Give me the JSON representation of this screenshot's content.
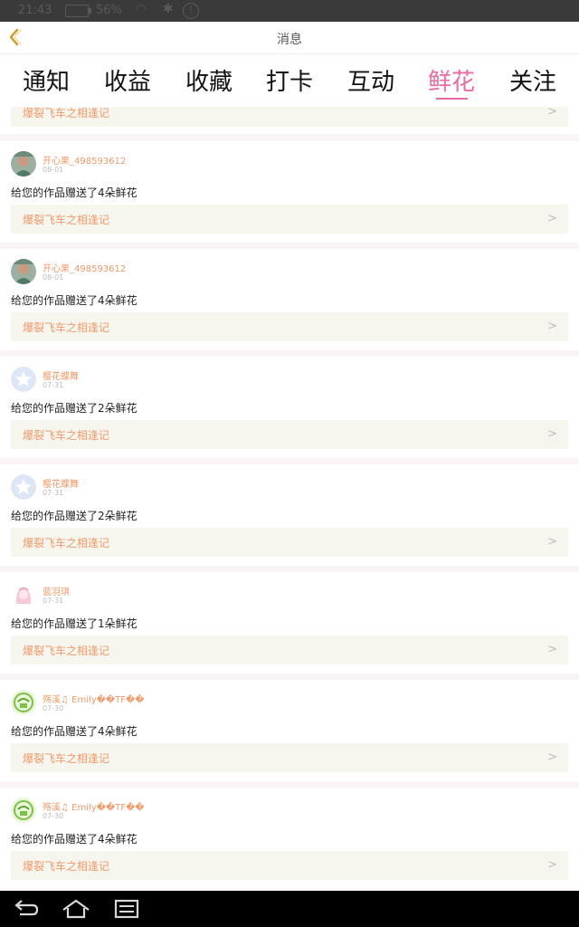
{
  "status_bar": {
    "time": "21:43",
    "battery": "56%"
  },
  "header": {
    "title": "消息"
  },
  "tabs": [
    {
      "label": "通知",
      "active": false
    },
    {
      "label": "收益",
      "active": false
    },
    {
      "label": "收藏",
      "active": false
    },
    {
      "label": "打卡",
      "active": false
    },
    {
      "label": "互动",
      "active": false
    },
    {
      "label": "鲜花",
      "active": true
    },
    {
      "label": "关注",
      "active": false
    }
  ],
  "top_partial": {
    "link_text": "爆裂飞车之相逢记"
  },
  "messages": [
    {
      "user": "开心果_498593612",
      "date": "08-01",
      "text": "给您的作品赠送了4朵鲜花",
      "link_text": "爆裂飞车之相逢记",
      "avatar": "photo"
    },
    {
      "user": "开心果_498593612",
      "date": "08-01",
      "text": "给您的作品赠送了4朵鲜花",
      "link_text": "爆裂飞车之相逢记",
      "avatar": "photo"
    },
    {
      "user": "樱花蝶舞",
      "date": "07-31",
      "text": "给您的作品赠送了2朵鲜花",
      "link_text": "爆裂飞车之相逢记",
      "avatar": "star"
    },
    {
      "user": "樱花蝶舞",
      "date": "07-31",
      "text": "给您的作品赠送了2朵鲜花",
      "link_text": "爆裂飞车之相逢记",
      "avatar": "star"
    },
    {
      "user": "蓝羽琪",
      "date": "07-31",
      "text": "给您的作品赠送了1朵鲜花",
      "link_text": "爆裂飞车之相逢记",
      "avatar": "anime"
    },
    {
      "user": "殇溪♫ Emily��TF��",
      "date": "07-30",
      "text": "给您的作品赠送了4朵鲜花",
      "link_text": "爆裂飞车之相逢记",
      "avatar": "green"
    },
    {
      "user": "殇溪♫ Emily��TF��",
      "date": "07-30",
      "text": "给您的作品赠送了4朵鲜花",
      "link_text": "爆裂飞车之相逢记",
      "avatar": "green"
    }
  ],
  "colors": {
    "accent": "#e86aa0",
    "link": "#ef9a6a",
    "link_bg": "#f6f5ee"
  }
}
